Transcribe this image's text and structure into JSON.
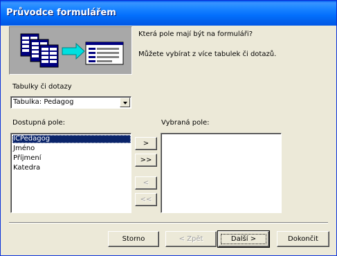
{
  "window": {
    "title": "Průvodce formulářem"
  },
  "intro": {
    "question": "Která pole mají být na formuláři?",
    "hint": "Můžete vybírat z více tabulek či dotazů."
  },
  "tables_label": "Tabulky či dotazy",
  "tables_combo": {
    "value": "Tabulka: Pedagog"
  },
  "available_label": "Dostupná pole:",
  "available_fields": [
    "ICPedagog",
    "Jméno",
    "Příjmení",
    "Katedra"
  ],
  "selected_label": "Vybraná pole:",
  "selected_fields": [],
  "move_buttons": {
    "add_one": ">",
    "add_all": ">>",
    "remove_one": "<",
    "remove_all": "<<"
  },
  "footer": {
    "cancel": "Storno",
    "back": "< Zpět",
    "next": "Další >",
    "finish": "Dokončit"
  },
  "colors": {
    "titlebar": "#0058ee",
    "selection": "#0a246a",
    "dialog": "#ece9d8"
  },
  "icons": {
    "wizard": "form-wizard-illustration-icon",
    "dropdown": "chevron-down-icon"
  }
}
